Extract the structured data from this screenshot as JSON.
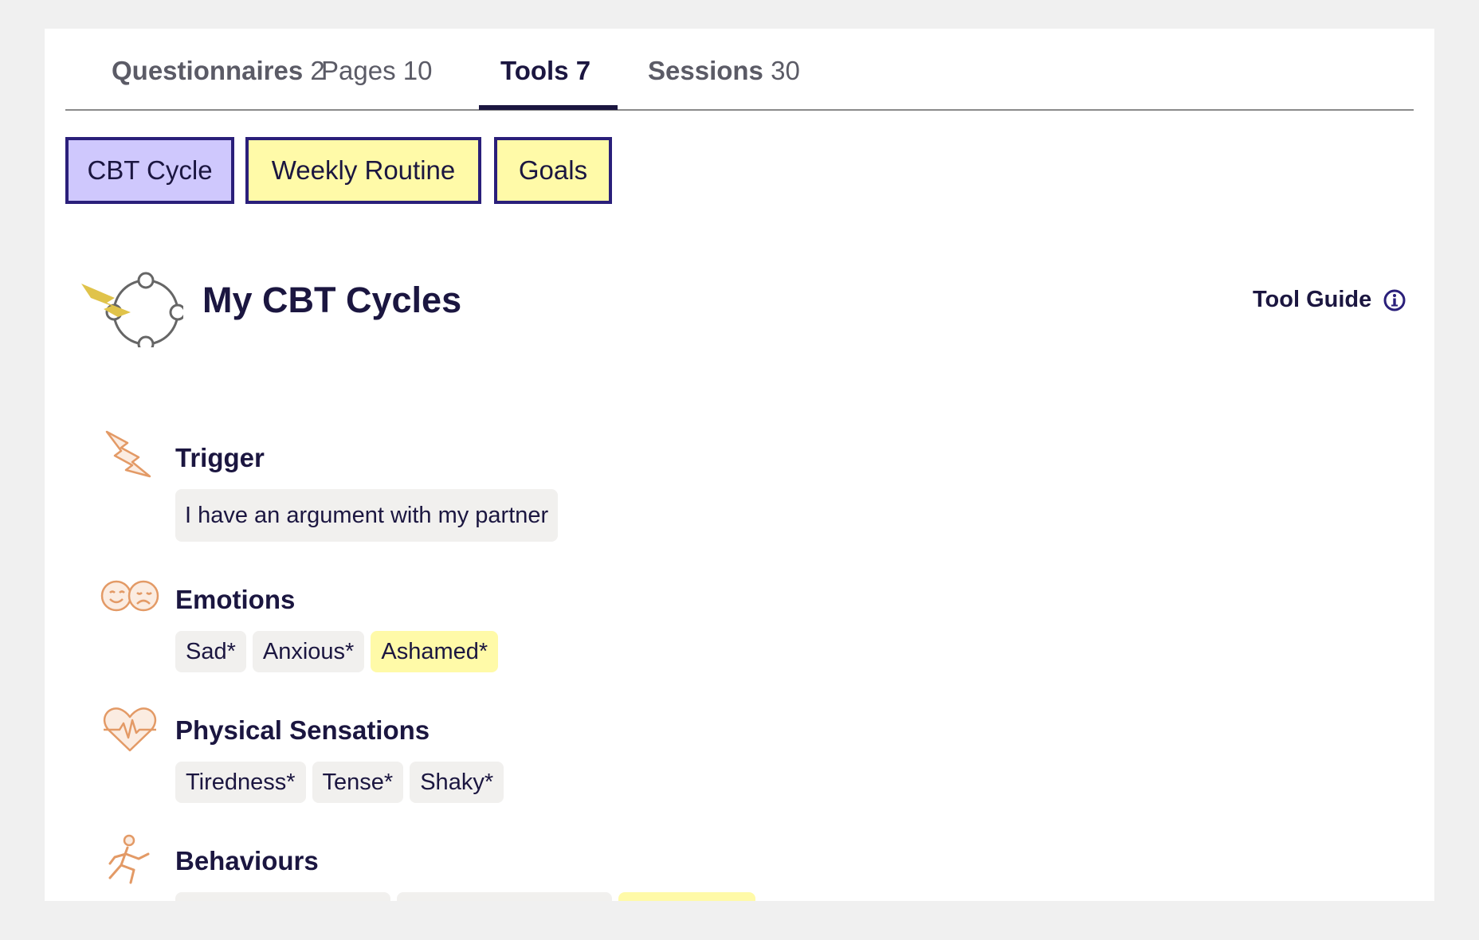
{
  "tabs": [
    {
      "label": "Questionnaires",
      "count": "2"
    },
    {
      "label": "Pages",
      "count": "10"
    },
    {
      "label": "Tools",
      "count": "7"
    },
    {
      "label": "Sessions",
      "count": "30"
    }
  ],
  "active_tab": "Tools",
  "tools": [
    {
      "label": "CBT Cycle",
      "active": true
    },
    {
      "label": "Weekly Routine",
      "active": false
    },
    {
      "label": "Goals",
      "active": false
    }
  ],
  "header": {
    "title": "My CBT Cycles",
    "tool_guide_label": "Tool Guide"
  },
  "sections": {
    "trigger": {
      "title": "Trigger",
      "items": [
        "I have an argument with my partner"
      ]
    },
    "emotions": {
      "title": "Emotions",
      "items": [
        "Sad*",
        "Anxious*",
        "Ashamed*"
      ],
      "highlighted": [
        "Ashamed*"
      ]
    },
    "physical": {
      "title": "Physical Sensations",
      "items": [
        "Tiredness*",
        "Tense*",
        "Shaky*"
      ]
    },
    "behaviours": {
      "title": "Behaviours"
    }
  },
  "colors": {
    "accent": "#2a1f7a",
    "active_tool_bg": "#cfc8fd",
    "inactive_tool_bg": "#fffaa8",
    "chip_bg": "#f1f0ee",
    "chip_highlight_bg": "#fffaa8",
    "icon_orange": "#e39a66",
    "logo_bolt": "#e0c34a"
  },
  "icons": [
    "cbt-cycle-logo-icon",
    "info-icon",
    "lightning-bolt-icon",
    "drama-masks-icon",
    "heartbeat-icon",
    "running-person-icon"
  ]
}
